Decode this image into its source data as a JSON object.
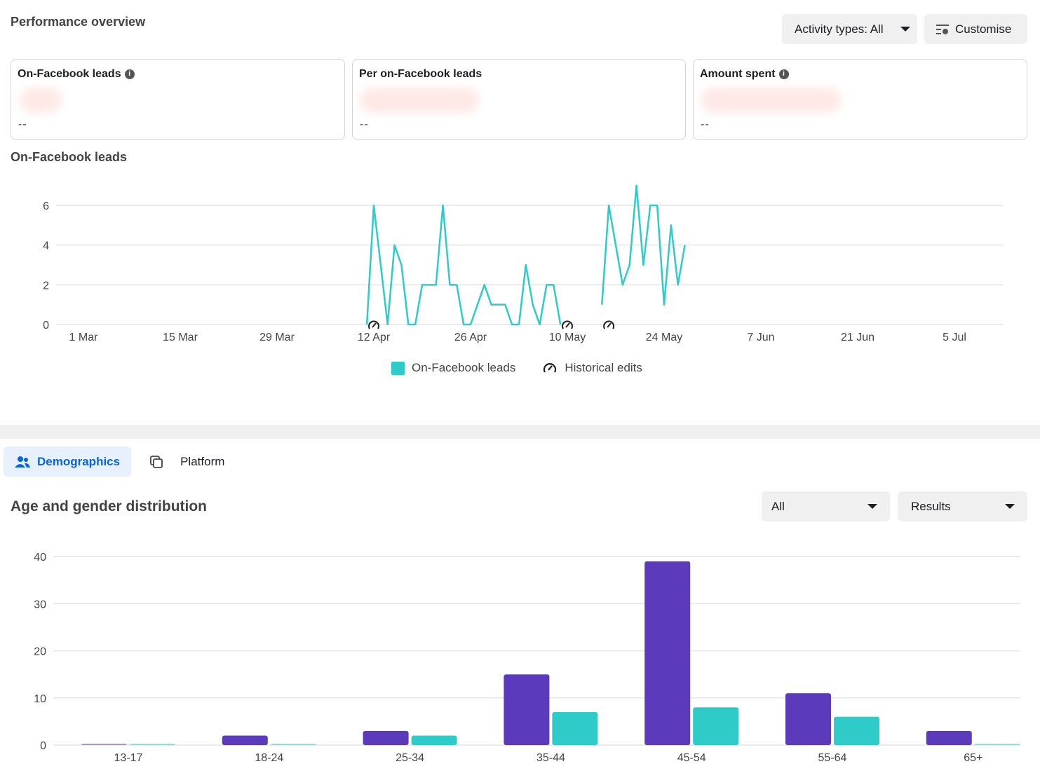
{
  "header": {
    "title": "Performance overview",
    "activity_label": "Activity types: All",
    "customise_label": "Customise"
  },
  "cards": [
    {
      "title": "On-Facebook leads",
      "info": true,
      "delta": "--"
    },
    {
      "title": "Per on-Facebook leads",
      "info": false,
      "delta": "--"
    },
    {
      "title": "Amount spent",
      "info": true,
      "delta": "--"
    }
  ],
  "line_section": {
    "title": "On-Facebook leads"
  },
  "tabs": [
    {
      "label": "Demographics",
      "active": true,
      "icon": "people-icon"
    },
    {
      "label": "Platform",
      "active": false,
      "icon": "platform-icon"
    }
  ],
  "demographics": {
    "title": "Age and gender distribution",
    "filter_value": "All",
    "metric_value": "Results"
  },
  "colors": {
    "teal": "#2ecbc9",
    "purple": "#5b3bbb",
    "accent": "#0a66d8"
  },
  "chart_data": [
    {
      "type": "line",
      "xlabel": "",
      "ylabel": "",
      "ylim": [
        0,
        7
      ],
      "yticks": [
        0,
        2,
        4,
        6
      ],
      "xticks": [
        "1 Mar",
        "15 Mar",
        "29 Mar",
        "12 Apr",
        "26 Apr",
        "10 May",
        "24 May",
        "7 Jun",
        "21 Jun",
        "5 Jul"
      ],
      "xrange": [
        "1 Mar",
        "5 Jul"
      ],
      "grid": true,
      "legend": {
        "position": "bottom",
        "entries": [
          {
            "label": "On-Facebook leads",
            "marker": "square"
          },
          {
            "label": "Historical edits",
            "marker": "edit-icon"
          }
        ]
      },
      "series": [
        {
          "name": "On-Facebook leads",
          "segments": [
            {
              "start": "11 Apr",
              "values": [
                0,
                6,
                3,
                0,
                4,
                3,
                0,
                0,
                2,
                2,
                2,
                6,
                2,
                2,
                0,
                0,
                1,
                2,
                1,
                1,
                1,
                0,
                0,
                3,
                1,
                0,
                2,
                2,
                0
              ]
            },
            {
              "start": "15 May",
              "values": [
                1,
                6,
                4,
                2,
                3,
                7,
                3,
                6,
                6,
                1,
                5,
                2,
                4
              ]
            }
          ]
        }
      ],
      "historical_edits": [
        "12 Apr",
        "10 May",
        "16 May"
      ]
    },
    {
      "type": "bar",
      "categories": [
        "13-17",
        "18-24",
        "25-34",
        "35-44",
        "45-54",
        "55-64",
        "65+"
      ],
      "series": [
        {
          "values": [
            0,
            2,
            3,
            15,
            39,
            11,
            3
          ]
        },
        {
          "values": [
            0,
            0,
            2,
            7,
            8,
            6,
            0
          ]
        }
      ],
      "ylim": [
        0,
        40
      ],
      "yticks": [
        0,
        10,
        20,
        30,
        40
      ],
      "grid": true
    }
  ]
}
